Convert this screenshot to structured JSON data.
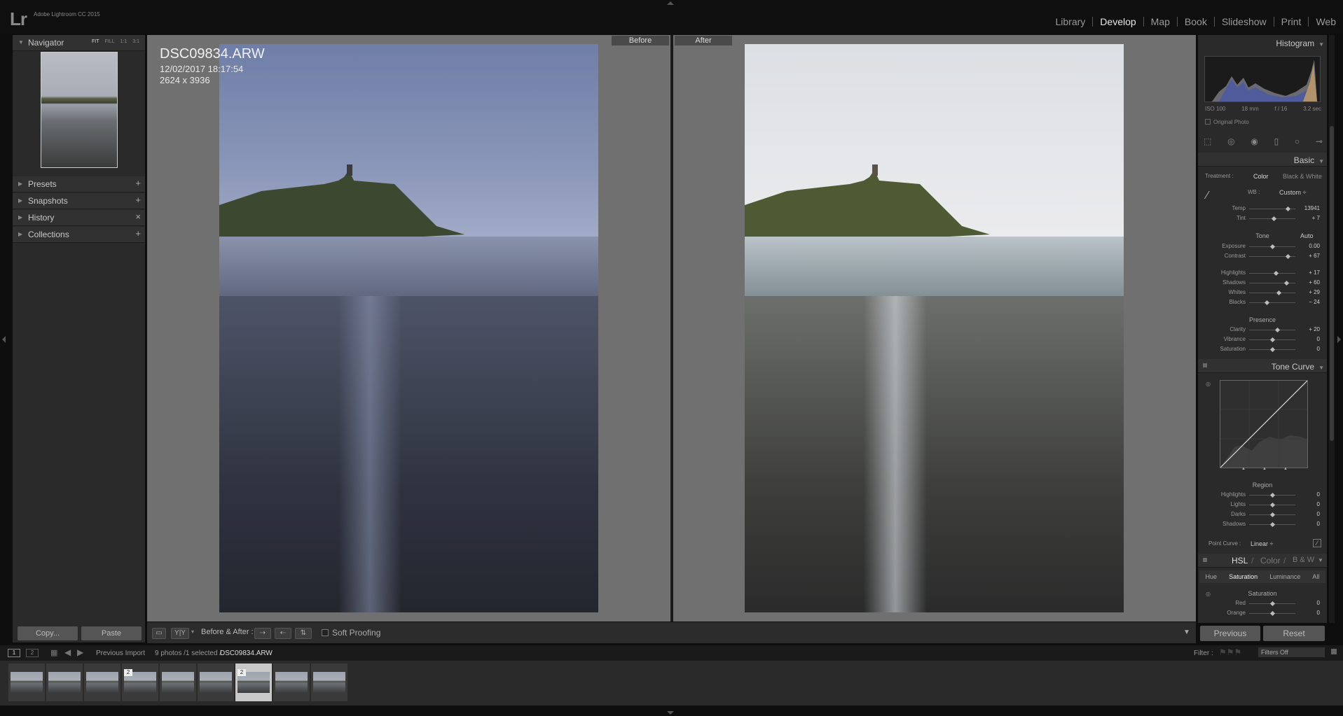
{
  "app": {
    "logo": "Lr",
    "name": "Adobe Lightroom CC 2015",
    "modules": [
      "Library",
      "Develop",
      "Map",
      "Book",
      "Slideshow",
      "Print",
      "Web"
    ],
    "active_module": "Develop"
  },
  "left_panel": {
    "navigator": {
      "title": "Navigator",
      "zoom": [
        "FIT",
        "FILL",
        "1:1",
        "3:1"
      ],
      "zoom_selected": "FIT"
    },
    "sections": [
      {
        "label": "Presets",
        "action": "+"
      },
      {
        "label": "Snapshots",
        "action": "+"
      },
      {
        "label": "History",
        "action": "×"
      },
      {
        "label": "Collections",
        "action": "+"
      }
    ],
    "copy_label": "Copy...",
    "paste_label": "Paste"
  },
  "center": {
    "before_label": "Before",
    "after_label": "After",
    "info": {
      "filename": "DSC09834.ARW",
      "datetime": "12/02/2017 18:17:54",
      "dimensions": "2624 x 3936"
    }
  },
  "toolbar": {
    "before_after_label": "Before & After :",
    "soft_proofing_label": "Soft Proofing",
    "view_label": "Y|Y"
  },
  "right_panel": {
    "histogram": {
      "title": "Histogram",
      "iso": "ISO 100",
      "focal": "18 mm",
      "aperture": "f / 16",
      "shutter": "3.2 sec",
      "original_photo": "Original Photo"
    },
    "basic": {
      "title": "Basic",
      "treatment_label": "Treatment :",
      "treatment_color": "Color",
      "treatment_bw": "Black & White",
      "wb_label": "WB :",
      "wb_value": "Custom ÷",
      "tone_label": "Tone",
      "auto_label": "Auto",
      "presence_label": "Presence",
      "wb_sliders": [
        {
          "label": "Temp",
          "value": "13941",
          "pos": 0.84
        },
        {
          "label": "Tint",
          "value": "+ 7",
          "pos": 0.53
        }
      ],
      "tone_sliders": [
        {
          "label": "Exposure",
          "value": "0.00",
          "pos": 0.5
        },
        {
          "label": "Contrast",
          "value": "+ 67",
          "pos": 0.83
        }
      ],
      "tone_sliders2": [
        {
          "label": "Highlights",
          "value": "+ 17",
          "pos": 0.58
        },
        {
          "label": "Shadows",
          "value": "+ 60",
          "pos": 0.8
        },
        {
          "label": "Whites",
          "value": "+ 29",
          "pos": 0.64
        },
        {
          "label": "Blacks",
          "value": "− 24",
          "pos": 0.38
        }
      ],
      "presence_sliders": [
        {
          "label": "Clarity",
          "value": "+ 20",
          "pos": 0.6
        },
        {
          "label": "Vibrance",
          "value": "0",
          "pos": 0.5
        },
        {
          "label": "Saturation",
          "value": "0",
          "pos": 0.5
        }
      ]
    },
    "tone_curve": {
      "title": "Tone Curve",
      "region_label": "Region",
      "sliders": [
        {
          "label": "Highlights",
          "value": "0",
          "pos": 0.5
        },
        {
          "label": "Lights",
          "value": "0",
          "pos": 0.5
        },
        {
          "label": "Darks",
          "value": "0",
          "pos": 0.5
        },
        {
          "label": "Shadows",
          "value": "0",
          "pos": 0.5
        }
      ],
      "point_curve_label": "Point Curve :",
      "point_curve_value": "Linear ÷"
    },
    "hsl": {
      "title_hsl": "HSL",
      "title_color": "Color",
      "title_bw": "B & W",
      "tabs": [
        "Hue",
        "Saturation",
        "Luminance",
        "All"
      ],
      "active_tab": "Saturation",
      "sub_label": "Saturation",
      "sliders": [
        {
          "label": "Red",
          "value": "0",
          "pos": 0.5
        },
        {
          "label": "Orange",
          "value": "0",
          "pos": 0.5
        }
      ]
    },
    "previous_label": "Previous",
    "reset_label": "Reset"
  },
  "filmstrip": {
    "screen1": "1",
    "screen2": "2",
    "source": "Previous Import",
    "count": "9 photos /1 selected /",
    "selected_file": "DSC09834.ARW",
    "filter_label": "Filter :",
    "filter_value": "Filters Off",
    "thumbs": [
      {
        "badge": ""
      },
      {
        "badge": ""
      },
      {
        "badge": ""
      },
      {
        "badge": "2"
      },
      {
        "badge": ""
      },
      {
        "badge": ""
      },
      {
        "badge": "2"
      },
      {
        "badge": ""
      },
      {
        "badge": ""
      }
    ],
    "selected_index": 6
  }
}
